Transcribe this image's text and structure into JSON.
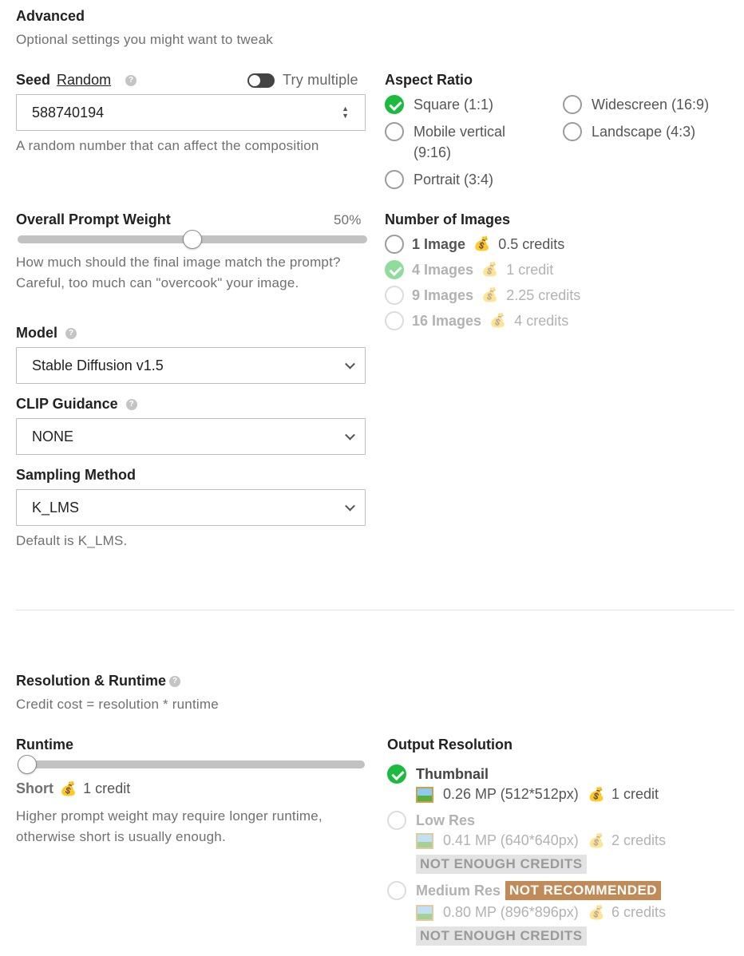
{
  "advanced": {
    "title": "Advanced",
    "subtitle": "Optional settings you might want to tweak"
  },
  "seed": {
    "label": "Seed",
    "random_link": "Random",
    "try_multiple_label": "Try multiple",
    "value": "588740194",
    "hint": "A random number that can affect the composition"
  },
  "aspect_ratio": {
    "label": "Aspect Ratio",
    "options": [
      {
        "label": "Square (1:1)",
        "selected": true
      },
      {
        "label": "Widescreen (16:9)",
        "selected": false
      },
      {
        "label": "Mobile vertical (9:16)",
        "selected": false
      },
      {
        "label": "Landscape (4:3)",
        "selected": false
      },
      {
        "label": "Portrait (3:4)",
        "selected": false
      }
    ]
  },
  "prompt_weight": {
    "label": "Overall Prompt Weight",
    "value_text": "50%",
    "value": 0.5,
    "hint": "How much should the final image match the prompt? Careful, too much can \"overcook\" your image."
  },
  "number_of_images": {
    "label": "Number of Images",
    "options": [
      {
        "count": "1 Image",
        "cost": "0.5 credits",
        "selected": false,
        "disabled": false
      },
      {
        "count": "4 Images",
        "cost": "1 credit",
        "selected": true,
        "disabled": true
      },
      {
        "count": "9 Images",
        "cost": "2.25 credits",
        "selected": false,
        "disabled": true
      },
      {
        "count": "16 Images",
        "cost": "4 credits",
        "selected": false,
        "disabled": true
      }
    ]
  },
  "model": {
    "label": "Model",
    "value": "Stable Diffusion v1.5"
  },
  "clip": {
    "label": "CLIP Guidance",
    "value": "NONE"
  },
  "sampling": {
    "label": "Sampling Method",
    "value": "K_LMS",
    "hint": "Default is K_LMS."
  },
  "resolution_runtime": {
    "title": "Resolution & Runtime",
    "subtitle": "Credit cost = resolution * runtime"
  },
  "runtime": {
    "label": "Runtime",
    "value": 0,
    "level": "Short",
    "cost": "1 credit",
    "hint": "Higher prompt weight may require longer runtime, otherwise short is usually enough."
  },
  "output_resolution": {
    "label": "Output Resolution",
    "options": [
      {
        "name": "Thumbnail",
        "mp": "0.26 MP (512*512px)",
        "cost": "1 credit",
        "selected": true
      },
      {
        "name": "Low Res",
        "mp": "0.41 MP (640*640px)",
        "cost": "2 credits",
        "status": "NOT ENOUGH CREDITS"
      },
      {
        "name": "Medium Res",
        "badge": "NOT RECOMMENDED",
        "mp": "0.80 MP (896*896px)",
        "cost": "6 credits",
        "status": "NOT ENOUGH CREDITS"
      }
    ]
  },
  "icons": {
    "money_bag": "💰",
    "help": "?"
  },
  "colors": {
    "check_green": "#1bbb3f",
    "badge_brown": "#c18a57"
  }
}
